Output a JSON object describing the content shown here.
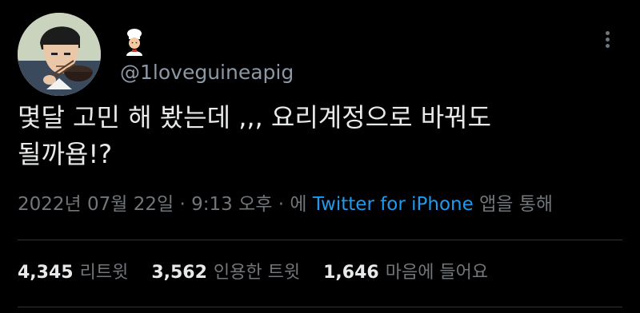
{
  "tweet": {
    "display_name_icon": "cook-emoji",
    "handle": "@1loveguineapig",
    "text": "몇달 고민 해 봤는데 ,,, 요리계정으로 바꿔도\n될까욥!?",
    "meta": {
      "date": "2022년 07월 22일",
      "sep1": " · ",
      "time": "9:13 오후",
      "sep2": " · ",
      "via_prefix": "에 ",
      "source": "Twitter for iPhone",
      "via_suffix": " 앱을 통해"
    },
    "stats": {
      "retweets": {
        "count": "4,345",
        "label": "리트윗"
      },
      "quotes": {
        "count": "3,562",
        "label": "인용한 트윗"
      },
      "likes": {
        "count": "1,646",
        "label": "마음에 들어요"
      }
    }
  },
  "colors": {
    "background": "#000000",
    "text": "#e7e9ea",
    "muted": "#71767b",
    "link": "#1d9bf0"
  }
}
